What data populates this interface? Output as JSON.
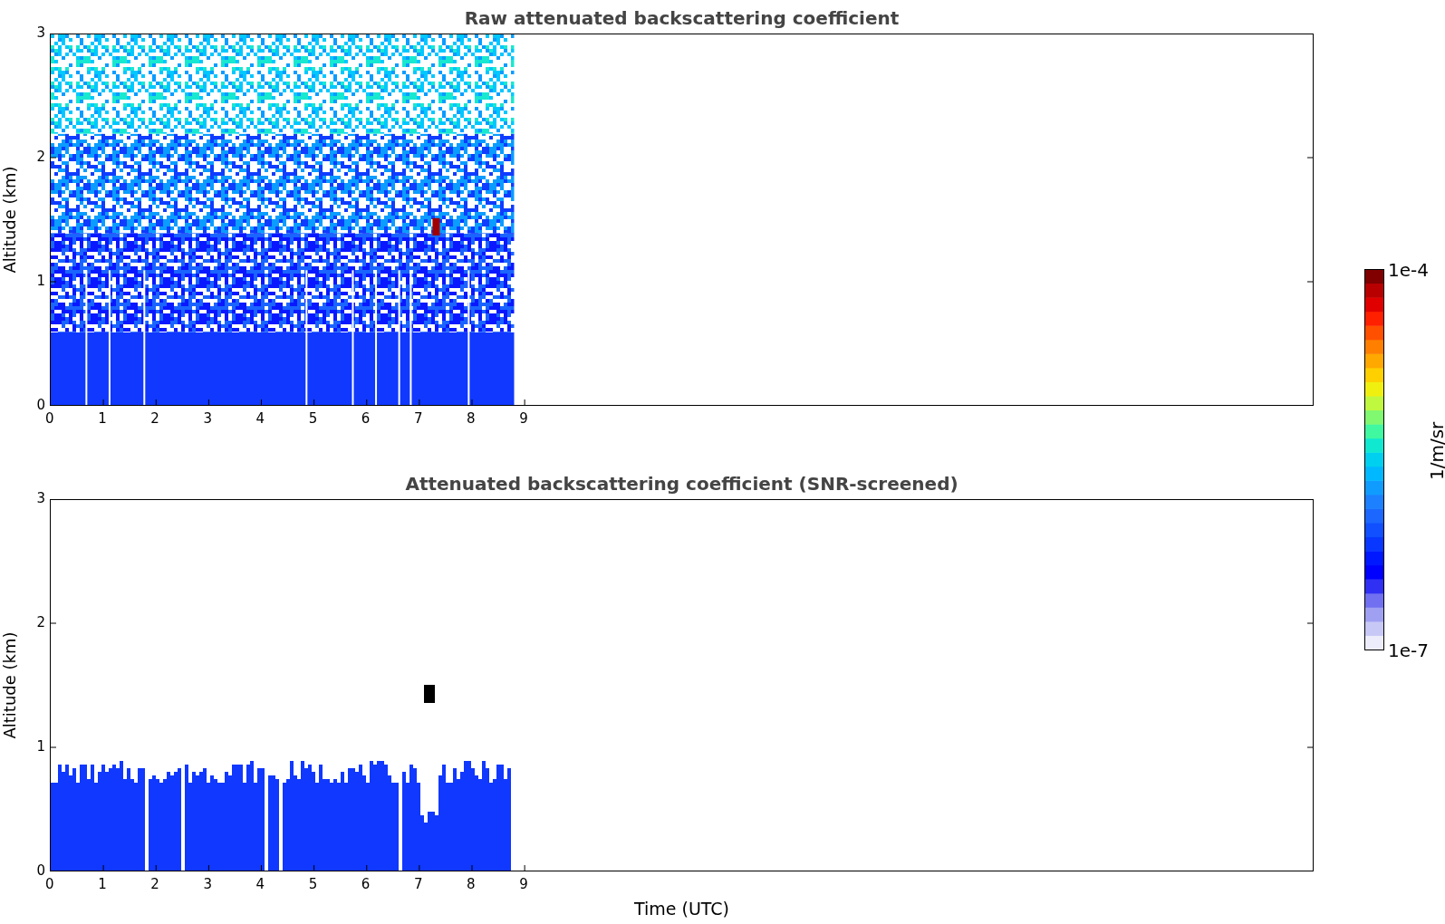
{
  "plots": [
    {
      "kind": "raw",
      "title": "Raw attenuated backscattering coefficient",
      "ylabel": "Altitude (km)",
      "yticks": [
        "3",
        "2",
        "1",
        "0"
      ],
      "xticks": [
        "0",
        "1",
        "2",
        "3",
        "4",
        "5",
        "6",
        "7",
        "8",
        "9"
      ]
    },
    {
      "kind": "screened",
      "title": "Attenuated backscattering coefficient (SNR-screened)",
      "ylabel": "Altitude (km)",
      "yticks": [
        "3",
        "2",
        "1",
        "0"
      ],
      "xticks": [
        "0",
        "1",
        "2",
        "3",
        "4",
        "5",
        "6",
        "7",
        "8",
        "9"
      ],
      "xlabel": "Time (UTC)"
    }
  ],
  "colorbar": {
    "max": "1e-4",
    "min": "1e-7",
    "label": "1/m/sr"
  }
}
